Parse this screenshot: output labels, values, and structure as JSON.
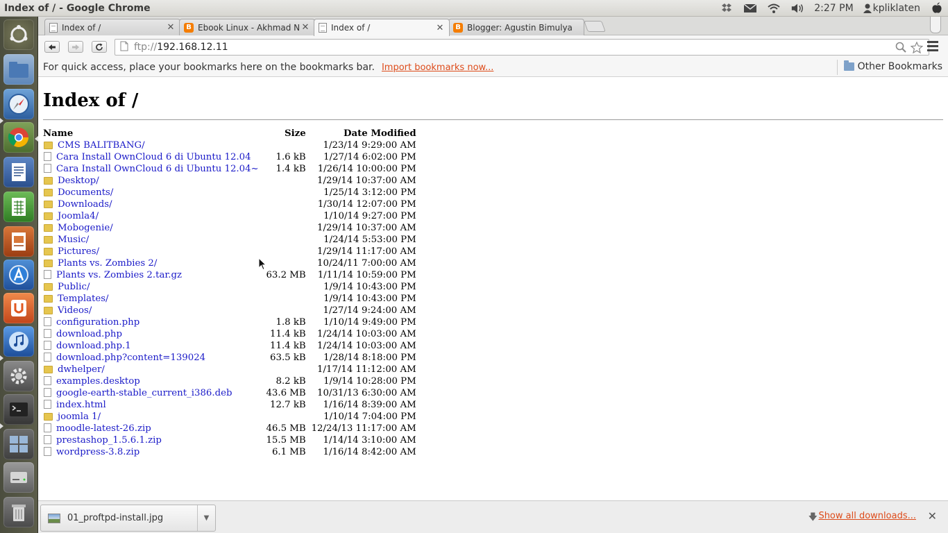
{
  "window": {
    "title": "Index of / - Google Chrome"
  },
  "tray": {
    "time": "2:27 PM",
    "user": "kpliklaten"
  },
  "launcher": {
    "items": [
      {
        "name": "ubuntu-dash"
      },
      {
        "name": "home-folder"
      },
      {
        "name": "safari"
      },
      {
        "name": "chrome"
      },
      {
        "name": "libreoffice-writer"
      },
      {
        "name": "libreoffice-calc"
      },
      {
        "name": "libreoffice-impress"
      },
      {
        "name": "app-store"
      },
      {
        "name": "ubuntu-one"
      },
      {
        "name": "itunes"
      },
      {
        "name": "system-settings"
      },
      {
        "name": "terminal"
      },
      {
        "name": "workspace-switcher"
      },
      {
        "name": "disk-drive"
      },
      {
        "name": "trash"
      }
    ]
  },
  "tabs": [
    {
      "label": "Index of /",
      "icon": "page-icon"
    },
    {
      "label": "Ebook Linux - Akhmad Nu",
      "icon": "blogger-icon"
    },
    {
      "label": "Index of /",
      "icon": "page-icon",
      "active": true
    },
    {
      "label": "Blogger: Agustin Bimulya",
      "icon": "blogger-icon"
    }
  ],
  "toolbar": {
    "url_scheme": "ftp://",
    "url_host": "192.168.12.11"
  },
  "bookmarks": {
    "hint": "For quick access, place your bookmarks here on the bookmarks bar.",
    "import_link": "Import bookmarks now...",
    "other": "Other Bookmarks"
  },
  "listing": {
    "heading": "Index of /",
    "columns": {
      "name": "Name",
      "size": "Size",
      "modified": "Date Modified"
    },
    "rows": [
      {
        "name": "CMS BALITBANG/",
        "size": "",
        "modified": "1/23/14 9:29:00 AM",
        "dir": true
      },
      {
        "name": "Cara Install OwnCloud 6 di Ubuntu 12.04",
        "size": "1.6 kB",
        "modified": "1/27/14 6:02:00 PM",
        "dir": false
      },
      {
        "name": "Cara Install OwnCloud 6 di Ubuntu 12.04~",
        "size": "1.4 kB",
        "modified": "1/26/14 10:00:00 PM",
        "dir": false
      },
      {
        "name": "Desktop/",
        "size": "",
        "modified": "1/29/14 10:37:00 AM",
        "dir": true
      },
      {
        "name": "Documents/",
        "size": "",
        "modified": "1/25/14 3:12:00 PM",
        "dir": true
      },
      {
        "name": "Downloads/",
        "size": "",
        "modified": "1/30/14 12:07:00 PM",
        "dir": true
      },
      {
        "name": "Joomla4/",
        "size": "",
        "modified": "1/10/14 9:27:00 PM",
        "dir": true
      },
      {
        "name": "Mobogenie/",
        "size": "",
        "modified": "1/29/14 10:37:00 AM",
        "dir": true
      },
      {
        "name": "Music/",
        "size": "",
        "modified": "1/24/14 5:53:00 PM",
        "dir": true
      },
      {
        "name": "Pictures/",
        "size": "",
        "modified": "1/29/14 11:17:00 AM",
        "dir": true
      },
      {
        "name": "Plants vs. Zombies 2/",
        "size": "",
        "modified": "10/24/11 7:00:00 AM",
        "dir": true
      },
      {
        "name": "Plants vs. Zombies 2.tar.gz",
        "size": "63.2 MB",
        "modified": "1/11/14 10:59:00 PM",
        "dir": false
      },
      {
        "name": "Public/",
        "size": "",
        "modified": "1/9/14 10:43:00 PM",
        "dir": true
      },
      {
        "name": "Templates/",
        "size": "",
        "modified": "1/9/14 10:43:00 PM",
        "dir": true
      },
      {
        "name": "Videos/",
        "size": "",
        "modified": "1/27/14 9:24:00 AM",
        "dir": true
      },
      {
        "name": "configuration.php",
        "size": "1.8 kB",
        "modified": "1/10/14 9:49:00 PM",
        "dir": false
      },
      {
        "name": "download.php",
        "size": "11.4 kB",
        "modified": "1/24/14 10:03:00 AM",
        "dir": false
      },
      {
        "name": "download.php.1",
        "size": "11.4 kB",
        "modified": "1/24/14 10:03:00 AM",
        "dir": false
      },
      {
        "name": "download.php?content=139024",
        "size": "63.5 kB",
        "modified": "1/28/14 8:18:00 PM",
        "dir": false
      },
      {
        "name": "dwhelper/",
        "size": "",
        "modified": "1/17/14 11:12:00 AM",
        "dir": true
      },
      {
        "name": "examples.desktop",
        "size": "8.2 kB",
        "modified": "1/9/14 10:28:00 PM",
        "dir": false
      },
      {
        "name": "google-earth-stable_current_i386.deb",
        "size": "43.6 MB",
        "modified": "10/31/13 6:30:00 AM",
        "dir": false
      },
      {
        "name": "index.html",
        "size": "12.7 kB",
        "modified": "1/16/14 8:39:00 AM",
        "dir": false
      },
      {
        "name": "joomla 1/",
        "size": "",
        "modified": "1/10/14 7:04:00 PM",
        "dir": true
      },
      {
        "name": "moodle-latest-26.zip",
        "size": "46.5 MB",
        "modified": "12/24/13 11:17:00 AM",
        "dir": false
      },
      {
        "name": "prestashop_1.5.6.1.zip",
        "size": "15.5 MB",
        "modified": "1/14/14 3:10:00 AM",
        "dir": false
      },
      {
        "name": "wordpress-3.8.zip",
        "size": "6.1 MB",
        "modified": "1/16/14 8:42:00 AM",
        "dir": false
      }
    ]
  },
  "downloads": {
    "item": "01_proftpd-install.jpg",
    "show_all": "Show all downloads..."
  }
}
